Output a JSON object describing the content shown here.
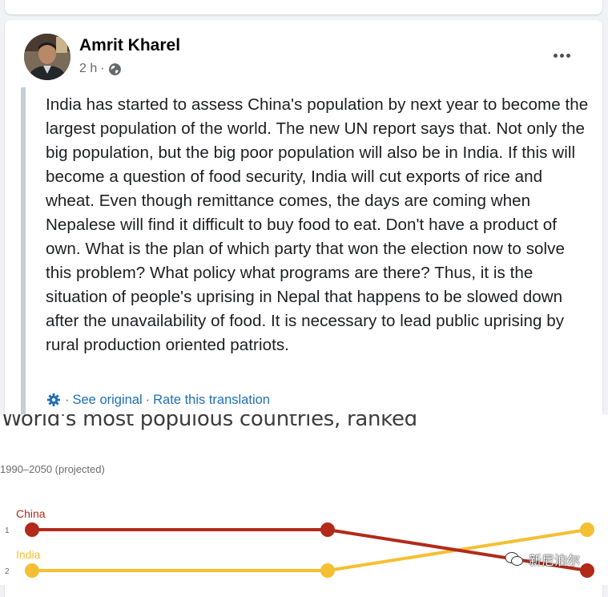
{
  "post": {
    "author": "Amrit Kharel",
    "time": "2 h",
    "audience_icon": "globe-icon",
    "more_icon": "more-options-icon",
    "text": "India has started to assess China's population by next year to become the largest population of the world. The new UN report says that. Not only the big population, but the big poor population will also be in India. If this will become a question of food security, India will cut exports of rice and wheat. Even though remittance comes, the days are coming when Nepalese will find it difficult to buy food to eat. Don't have a product of own. What is the plan of which party that won the election now to solve this problem? What policy what programs are there? Thus, it is the situation of people's uprising in Nepal that happens to be slowed down after the unavailability of food. It is necessary to lead public uprising by rural production oriented patriots.",
    "translation": {
      "see_original": "See original",
      "separator": "·",
      "rate": "Rate this translation"
    }
  },
  "chart_data": {
    "type": "line",
    "title": "World's most populous countries, ranked",
    "subtitle": "1990–2050 (projected)",
    "y_ticks": [
      "1",
      "2"
    ],
    "x_points": 3,
    "series": [
      {
        "name": "China",
        "color": "#b22a1a",
        "values": [
          1,
          1,
          2
        ]
      },
      {
        "name": "India",
        "color": "#f5bf33",
        "values": [
          2,
          2,
          1
        ]
      }
    ]
  },
  "watermark": {
    "text": "新尼泊尔",
    "icon": "wechat-icon"
  },
  "colors": {
    "link": "#1f6fb5",
    "secondary_text": "#65676b",
    "china": "#b22a1a",
    "india": "#f5bf33"
  }
}
